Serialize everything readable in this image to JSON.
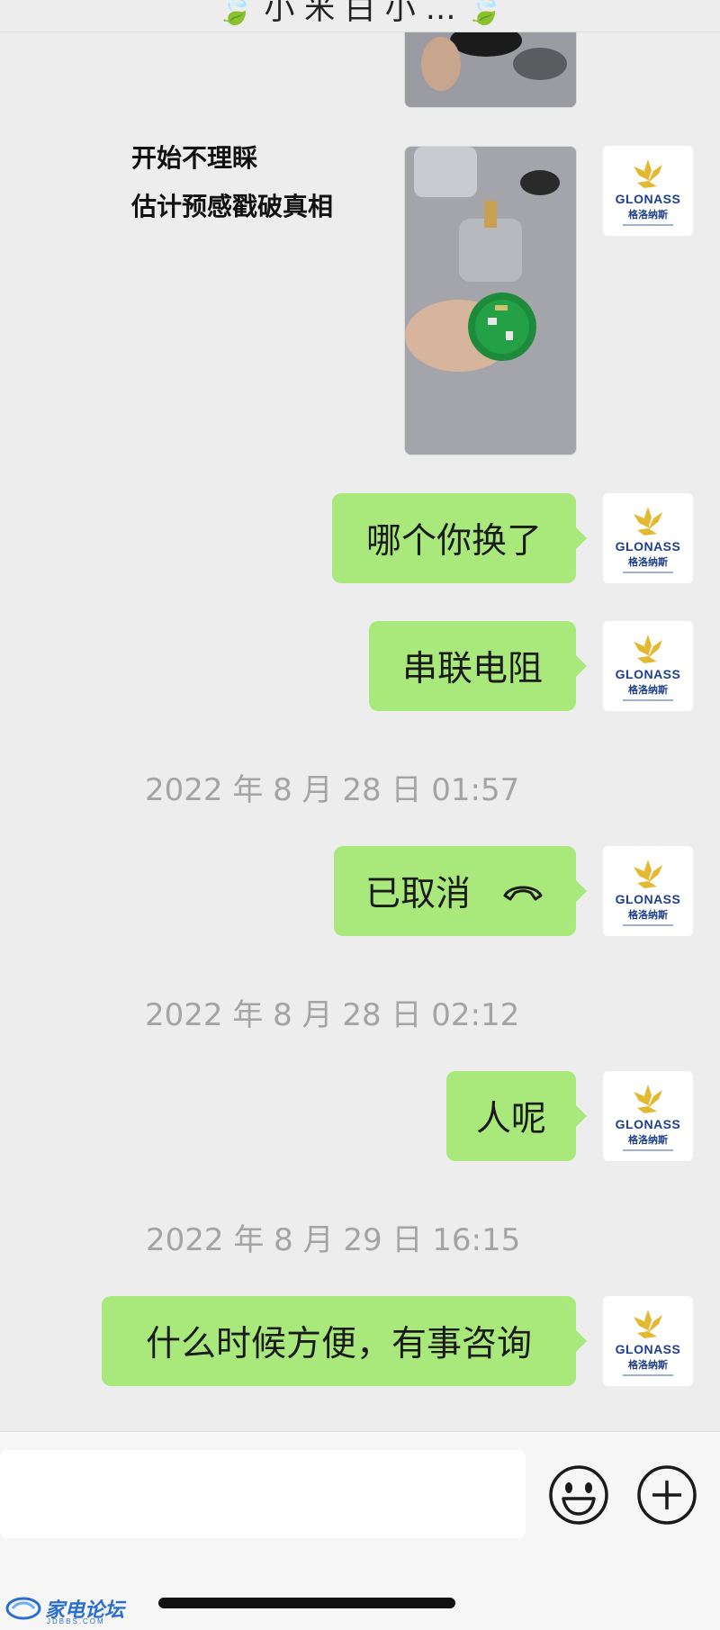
{
  "header": {
    "title": "🍃 小 米 白 小 … 🍃"
  },
  "contact": {
    "brand": "GLONASS",
    "brand_cn": "格洛纳斯"
  },
  "messages": {
    "caption_line1": "开始不理睬",
    "caption_line2": "估计预感戳破真相",
    "msg1": "哪个你换了",
    "msg2": "串联电阻",
    "ts1": "2022 年 8 月 28 日 01:57",
    "call": "已取消",
    "ts2": "2022 年 8 月 28 日 02:12",
    "msg3": "人呢",
    "ts3": "2022 年 8 月 29 日 16:15",
    "msg4": "什么时候方便，有事咨询"
  },
  "input": {
    "placeholder": ""
  },
  "watermark": {
    "text": "家电论坛",
    "sub": "JDBBS.COM"
  },
  "colors": {
    "sent_bubble": "#a9e97b",
    "background": "#ededed",
    "brand_blue": "#1f3f8a",
    "brand_gold": "#e3b931"
  }
}
